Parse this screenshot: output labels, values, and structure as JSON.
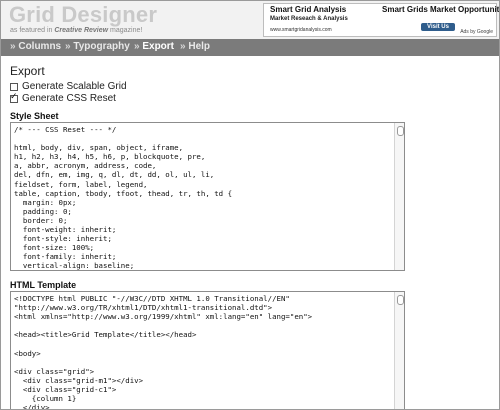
{
  "header": {
    "logo": "Grid Designer",
    "tagline_prefix": "as featured in ",
    "tagline_source": "Creative Review",
    "tagline_suffix": " magazine!"
  },
  "ad": {
    "left_title": "Smart Grid Analysis",
    "left_subtitle": "Market Reseach & Analysis",
    "left_url": "www.smartgridanalysis.com",
    "right_title": "Smart Grids Market Opportunitie",
    "right_button": "Visit Us",
    "ads_by": "Ads by Google"
  },
  "nav": {
    "items": [
      {
        "label": "Columns"
      },
      {
        "label": "Typography"
      },
      {
        "label": "Export"
      },
      {
        "label": "Help"
      }
    ],
    "arrow": "»"
  },
  "export": {
    "title": "Export",
    "options": [
      {
        "label": "Generate Scalable Grid",
        "checked": false
      },
      {
        "label": "Generate CSS Reset",
        "checked": true
      }
    ]
  },
  "stylesheet": {
    "label": "Style Sheet",
    "code": "/* --- CSS Reset --- */\n\nhtml, body, div, span, object, iframe,\nh1, h2, h3, h4, h5, h6, p, blockquote, pre,\na, abbr, acronym, address, code,\ndel, dfn, em, img, q, dl, dt, dd, ol, ul, li,\nfieldset, form, label, legend,\ntable, caption, tbody, tfoot, thead, tr, th, td {\n  margin: 0px;\n  padding: 0;\n  border: 0;\n  font-weight: inherit;\n  font-style: inherit;\n  font-size: 100%;\n  font-family: inherit;\n  vertical-align: baseline;"
  },
  "html_template": {
    "label": "HTML Template",
    "code": "<!DOCTYPE html PUBLIC \"-//W3C//DTD XHTML 1.0 Transitional//EN\"\n\"http://www.w3.org/TR/xhtml1/DTD/xhtml1-transitional.dtd\">\n<html xmlns=\"http://www.w3.org/1999/xhtml\" xml:lang=\"en\" lang=\"en\">\n\n<head><title>Grid Template</title></head>\n\n<body>\n\n<div class=\"grid\">\n  <div class=\"grid-m1\"></div>\n  <div class=\"grid-c1\">\n    {column 1}\n  </div>"
  }
}
